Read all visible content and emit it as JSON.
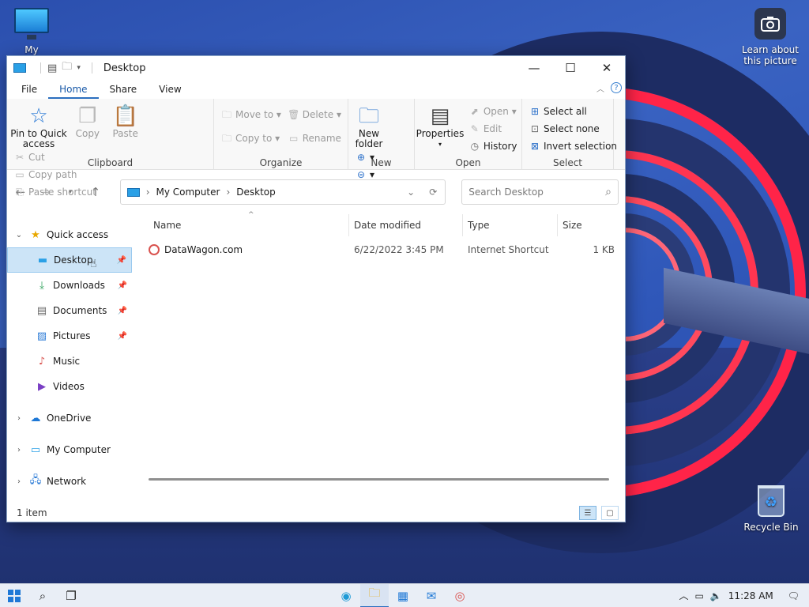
{
  "desktop": {
    "mycomputer_label": "My Computer",
    "learn_label_line1": "Learn about",
    "learn_label_line2": "this picture",
    "recycle_label": "Recycle Bin"
  },
  "window": {
    "title": "Desktop",
    "controls": {
      "minimize": "—",
      "maximize": "☐",
      "close": "✕"
    }
  },
  "tabs": {
    "file": "File",
    "home": "Home",
    "share": "Share",
    "view": "View",
    "help": "?"
  },
  "ribbon": {
    "clipboard": {
      "label": "Clipboard",
      "pin_line1": "Pin to Quick",
      "pin_line2": "access",
      "copy": "Copy",
      "paste": "Paste",
      "cut": "Cut",
      "copy_path": "Copy path",
      "paste_shortcut": "Paste shortcut"
    },
    "organize": {
      "label": "Organize",
      "move_to": "Move to",
      "copy_to": "Copy to",
      "delete": "Delete",
      "rename": "Rename"
    },
    "new": {
      "label": "New",
      "new_folder_line1": "New",
      "new_folder_line2": "folder"
    },
    "open": {
      "label": "Open",
      "properties": "Properties",
      "open": "Open",
      "edit": "Edit",
      "history": "History"
    },
    "select": {
      "label": "Select",
      "select_all": "Select all",
      "select_none": "Select none",
      "invert": "Invert selection"
    }
  },
  "address": {
    "crumb1": "My Computer",
    "crumb2": "Desktop",
    "search_placeholder": "Search Desktop"
  },
  "sidebar": {
    "quick_access": "Quick access",
    "items": [
      {
        "label": "Desktop"
      },
      {
        "label": "Downloads"
      },
      {
        "label": "Documents"
      },
      {
        "label": "Pictures"
      },
      {
        "label": "Music"
      },
      {
        "label": "Videos"
      }
    ],
    "onedrive": "OneDrive",
    "mycomputer": "My Computer",
    "network": "Network"
  },
  "columns": {
    "name": "Name",
    "date": "Date modified",
    "type": "Type",
    "size": "Size"
  },
  "files": [
    {
      "name": "DataWagon.com",
      "date": "6/22/2022 3:45 PM",
      "type": "Internet Shortcut",
      "size": "1 KB"
    }
  ],
  "status": {
    "count": "1 item"
  },
  "taskbar": {
    "time": "11:28 AM"
  },
  "colors": {
    "accent": "#2b6fbf",
    "selection": "#cce4f7",
    "wallpaper_red": "#ff2448"
  }
}
